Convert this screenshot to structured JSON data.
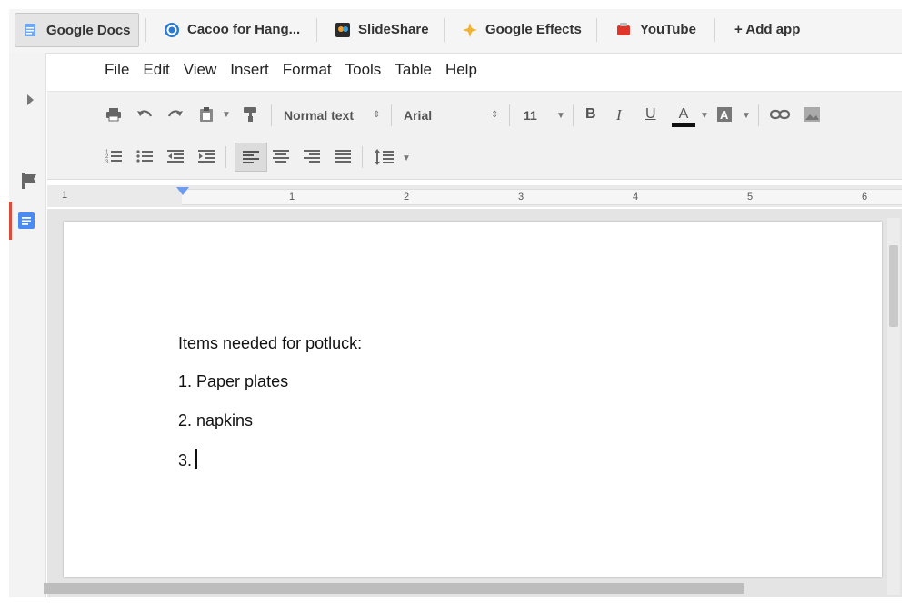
{
  "appbar": {
    "apps": [
      {
        "label": "Google Docs",
        "icon": "docs-icon",
        "active": true
      },
      {
        "label": "Cacoo for Hang...",
        "icon": "cacoo-icon"
      },
      {
        "label": "SlideShare",
        "icon": "slideshare-icon"
      },
      {
        "label": "Google Effects",
        "icon": "sparkle-icon"
      },
      {
        "label": "YouTube",
        "icon": "youtube-icon"
      }
    ],
    "add_app": "+ Add app"
  },
  "menu": [
    "File",
    "Edit",
    "View",
    "Insert",
    "Format",
    "Tools",
    "Table",
    "Help"
  ],
  "toolbar": {
    "style": "Normal text",
    "font": "Arial",
    "size": "11",
    "bold": "B",
    "italic": "I",
    "underline": "U",
    "text_color": "A"
  },
  "ruler": {
    "labels": [
      "1",
      "1",
      "2",
      "3",
      "4",
      "5",
      "6"
    ]
  },
  "document": {
    "lines": [
      "Items needed for potluck:",
      "1. Paper plates",
      "2. napkins",
      "3."
    ]
  },
  "colors": {
    "accent_red": "#dd4b39",
    "ruler_marker": "#6b9cf0",
    "docs_blue": "#4a8af4"
  }
}
